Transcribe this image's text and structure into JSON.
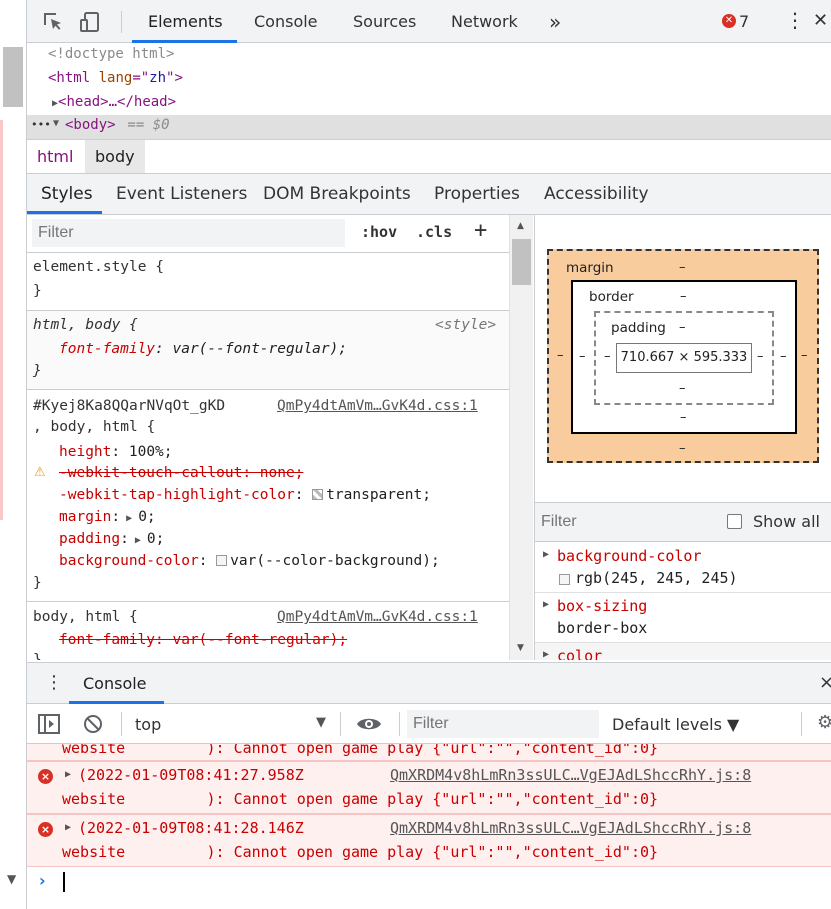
{
  "top_tabs": [
    "Elements",
    "Console",
    "Sources",
    "Network"
  ],
  "more_tabs": "»",
  "error_count": "7",
  "dom": {
    "doctype": "<!doctype html>",
    "html_tag_open": "<html",
    "html_attr": "lang",
    "html_attr_eq": "=\"",
    "html_attr_val": "zh",
    "html_tag_close": "\">",
    "head_line": "<head>…</head>",
    "body_dots": "•••",
    "body_tag": "<body>",
    "body_suffix": " == $0"
  },
  "breadcrumb": [
    "html",
    "body"
  ],
  "sub_tabs": [
    "Styles",
    "Event Listeners",
    "DOM Breakpoints",
    "Properties",
    "Accessibility"
  ],
  "styles_filter": {
    "placeholder": "Filter",
    "hov": ":hov",
    "cls": ".cls",
    "add": "+"
  },
  "rules": {
    "r1_sel": "element.style {",
    "brace": "}",
    "r2_sel": "html, body {",
    "r2_src": "<style>",
    "r2_prop": "font-family",
    "r2_val": "var(--font-regular);",
    "r3_sel1": "#Kyej8Ka8QQarNVqOt_gKD",
    "r3_src": "QmPy4dtAmVm…GvK4d.css:1",
    "r3_sel2": ", body, html {",
    "r3_height": "height",
    "r3_height_val": "100%;",
    "r3_callout": "-webkit-touch-callout: none;",
    "r3_tap": "-webkit-tap-highlight-color",
    "r3_tap_val": "transparent;",
    "r3_margin": "margin",
    "r3_margin_val": "0;",
    "r3_padding": "padding",
    "r3_padding_val": "0;",
    "r3_bg": "background-color",
    "r3_bg_val": "var(--color-background);",
    "r4_sel": "body, html {",
    "r4_src": "QmPy4dtAmVm…GvK4d.css:1",
    "r4_prop": "font-family: var(--font-regular);"
  },
  "box_model": {
    "margin_label": "margin",
    "border_label": "border",
    "padding_label": "padding",
    "dash": "–",
    "content": "710.667 × 595.333"
  },
  "computed": {
    "filter_placeholder": "Filter",
    "show_all": "Show all",
    "props": [
      {
        "name": "background-color",
        "value": "rgb(245, 245, 245)"
      },
      {
        "name": "box-sizing",
        "value": "border-box"
      },
      {
        "name": "color",
        "value": ""
      }
    ]
  },
  "drawer": {
    "tab": "Console",
    "close": "×"
  },
  "console_toolbar": {
    "context": "top",
    "filter_placeholder": "Filter",
    "levels": "Default levels ▼"
  },
  "messages": {
    "partial": "website         ): Cannot open game play {\"url\":\"\",\"content_id\":0}",
    "m1_head": "(2022-01-09T08:41:27.958Z",
    "m1_src": "QmXRDM4v8hLmRn3ssULC…VgEJAdLShccRhY.js:8",
    "m1_body": "website         ): Cannot open game play {\"url\":\"\",\"content_id\":0}",
    "m2_head": "(2022-01-09T08:41:28.146Z",
    "m2_src": "QmXRDM4v8hLmRn3ssULC…VgEJAdLShccRhY.js:8",
    "m2_body": "website         ): Cannot open game play {\"url\":\"\",\"content_id\":0}"
  },
  "colors": {
    "accent": "#1a73e8",
    "error": "#d93025",
    "margin_box": "#f9cc9d",
    "swatch_bg": "#f5f5f5"
  }
}
